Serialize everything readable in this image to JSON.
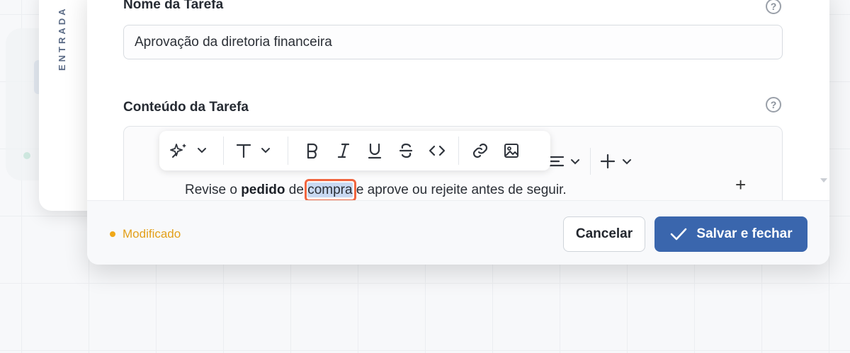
{
  "background": {
    "panel_label": "ENTRADA"
  },
  "modal": {
    "name_field": {
      "label": "Nome da Tarefa",
      "value": "Aprovação da diretoria financeira"
    },
    "content_field": {
      "label": "Conteúdo da Tarefa",
      "text_before": "Revise o ",
      "text_bold": "pedido",
      "text_middle": " de ",
      "text_selected": "compra",
      "text_after": " e aprove ou rejeite antes de seguir."
    },
    "toolbar": {
      "icons": [
        "ai-sparkle-icon",
        "text-style-icon",
        "bold-icon",
        "italic-icon",
        "underline-icon",
        "strikethrough-icon",
        "code-icon",
        "link-icon",
        "image-icon",
        "align-icon",
        "insert-icon"
      ]
    },
    "footer": {
      "status": "Modificado",
      "cancel_label": "Cancelar",
      "save_label": "Salvar e fechar"
    }
  },
  "colors": {
    "primary": "#3a66ad",
    "status": "#f0a818",
    "selection_highlight": "#f0653f"
  }
}
